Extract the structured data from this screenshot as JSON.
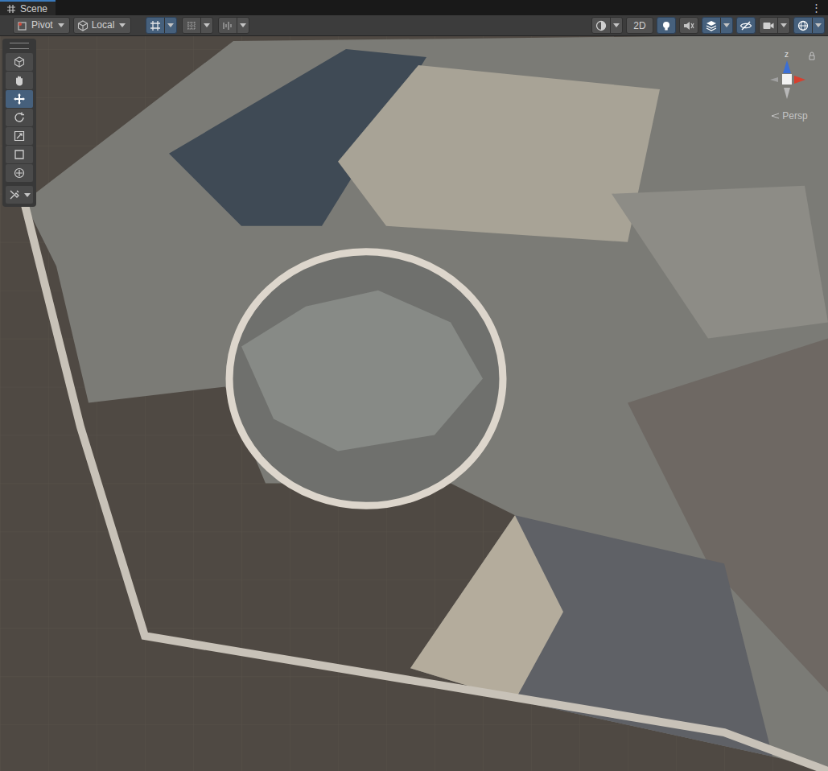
{
  "window": {
    "tab": "Scene",
    "menu": "⋮"
  },
  "toolbar": {
    "handle_buttons": [
      {
        "label": "Pivot",
        "kind": "pivot"
      },
      {
        "label": "Local",
        "kind": "local"
      }
    ],
    "snap_toggles": [
      {
        "kind": "grid-snap",
        "selected": true
      },
      {
        "kind": "grid",
        "selected": false
      },
      {
        "kind": "increment",
        "selected": false
      }
    ],
    "view_options": [
      {
        "kind": "shading",
        "label": "",
        "selected": false,
        "dropdown": true
      },
      {
        "kind": "text",
        "label": "2D",
        "selected": false,
        "dropdown": false
      },
      {
        "kind": "lighting",
        "label": "",
        "selected": true,
        "dropdown": false
      },
      {
        "kind": "audio",
        "label": "",
        "selected": false,
        "dropdown": false
      },
      {
        "kind": "effects",
        "label": "",
        "selected": true,
        "dropdown": true
      },
      {
        "kind": "visibility",
        "label": "",
        "selected": true,
        "dropdown": false
      },
      {
        "kind": "camera",
        "label": "",
        "selected": false,
        "dropdown": true
      },
      {
        "kind": "gizmos",
        "label": "",
        "selected": true,
        "dropdown": true
      }
    ]
  },
  "tools": [
    {
      "kind": "view",
      "selected": false
    },
    {
      "kind": "hand",
      "selected": false
    },
    {
      "kind": "move",
      "selected": true
    },
    {
      "kind": "rotate",
      "selected": false
    },
    {
      "kind": "scale",
      "selected": false
    },
    {
      "kind": "rect",
      "selected": false
    },
    {
      "kind": "transform",
      "selected": false
    },
    {
      "kind": "custom",
      "selected": false
    }
  ],
  "gizmo": {
    "axis_label": "z",
    "projection": "Persp"
  }
}
